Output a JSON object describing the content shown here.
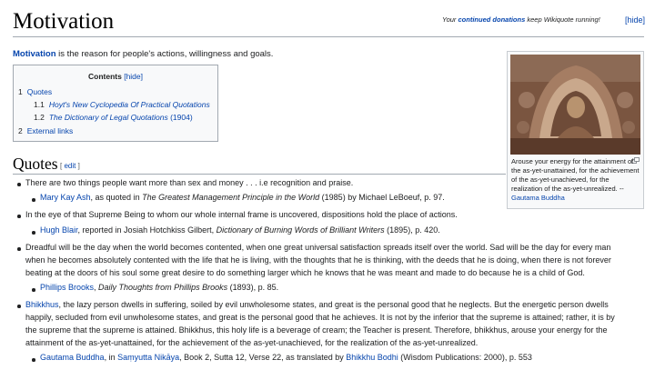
{
  "page": {
    "title": "Motivation",
    "notice_prefix": "Your ",
    "notice_link": "continued donations",
    "notice_suffix": " keep Wikiquote running!",
    "notice_hide": "[hide]"
  },
  "intro": {
    "term": "Motivation",
    "text": " is the reason for people's actions, willingness and goals."
  },
  "toc": {
    "title": "Contents",
    "hide": "[hide]",
    "items": [
      {
        "num": "1",
        "label": "Quotes"
      },
      {
        "num": "1.1",
        "label": "Hoyt's New Cyclopedia Of Practical Quotations"
      },
      {
        "num": "1.2",
        "label": "The Dictionary of Legal Quotations",
        "suffix": " (1904)"
      },
      {
        "num": "2",
        "label": "External links"
      }
    ]
  },
  "thumb": {
    "caption": "Arouse your energy for the attainment of the as-yet-unattained, for the achievement of the as-yet-unachieved, for the realization of the as-yet-unrealized. -- ",
    "caption_link": "Gautama Buddha"
  },
  "section": {
    "heading": "Quotes",
    "edit_open": "[ ",
    "edit_link": "edit",
    "edit_close": " ]"
  },
  "quotes": [
    {
      "text": "There are two things people want more than sex and money . . . i.e recognition and praise.",
      "attr_link": "Mary Kay Ash",
      "attr_mid": ", as quoted in ",
      "attr_work": "The Greatest Management Principle in the World",
      "attr_end": " (1985) by Michael LeBoeuf, p. 97."
    },
    {
      "text": "In the eye of that Supreme Being to whom our whole internal frame is uncovered, dispositions hold the place of actions.",
      "attr_link": "Hugh Blair",
      "attr_mid": ", reported in Josiah Hotchkiss Gilbert, ",
      "attr_work": "Dictionary of Burning Words of Brilliant Writers",
      "attr_end": " (1895), p. 420."
    },
    {
      "line1": "Dreadful will be the day when the world becomes contented, when one great universal satisfaction spreads itself over the world. Sad will be the day for every man",
      "line2": "when he becomes absolutely contented with the life that he is living, with the thoughts that he is thinking, with the deeds that he is doing, when there is not forever",
      "line3": "beating at the doors of his soul some great desire to do something larger which he knows that he was meant and made to do because he is a child of God.",
      "attr_link": "Phillips Brooks",
      "attr_mid": ", ",
      "attr_work": "Daily Thoughts from Phillips Brooks",
      "attr_end": " (1893), p. 85."
    },
    {
      "lead_link": "Bhikkhus",
      "line1": ", the lazy person dwells in suffering, soiled by evil unwholesome states, and great is the personal good that he neglects. But the energetic person dwells",
      "line2": "happily, secluded from evil unwholesome states, and great is the personal good that he achieves. It is not by the inferior that the supreme is attained; rather, it is by",
      "line3": "the supreme that the supreme is attained. Bhikkhus, this holy life is a beverage of cream; the Teacher is present. Therefore, bhikkhus, arouse your energy for the",
      "line4": "attainment of the as-yet-unattained, for the achievement of the as-yet-unachieved, for the realization of the as-yet-unrealized.",
      "attr_link": "Gautama Buddha",
      "attr_mid": ", in ",
      "attr_work_link": "Saṃyutta Nikāya",
      "attr_mid2": ", Book 2, Sutta 12, Verse 22, as translated by ",
      "attr_link2": "Bhikkhu Bodhi",
      "attr_end": " (Wisdom Publications: 2000), p. 553"
    }
  ]
}
